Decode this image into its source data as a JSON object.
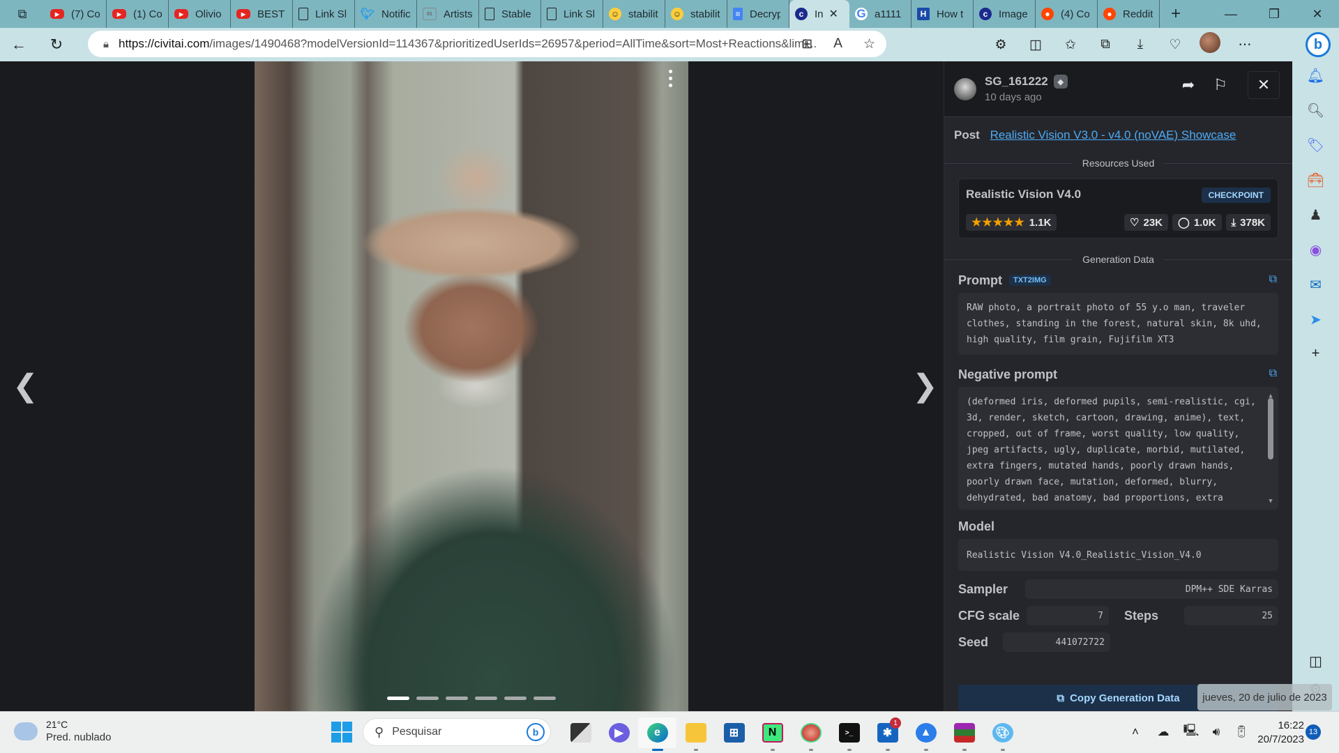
{
  "browser": {
    "tabs": [
      {
        "icon": "youtube-icon",
        "label": "(7) Co"
      },
      {
        "icon": "youtube-icon",
        "label": "(1) Co"
      },
      {
        "icon": "youtube-icon",
        "label": "Olivio"
      },
      {
        "icon": "youtube-icon",
        "label": "BEST A"
      },
      {
        "icon": "document-icon",
        "label": "Link Sl"
      },
      {
        "icon": "twitter-icon",
        "label": "Notific"
      },
      {
        "icon": "binary-grid-icon",
        "label": "Artists"
      },
      {
        "icon": "document-icon",
        "label": "Stable"
      },
      {
        "icon": "document-icon",
        "label": "Link Sl"
      },
      {
        "icon": "huggingface-icon",
        "label": "stabilit"
      },
      {
        "icon": "huggingface-icon",
        "label": "stabilit"
      },
      {
        "icon": "google-docs-icon",
        "label": "Decryp"
      },
      {
        "icon": "civitai-icon",
        "label": "In",
        "active": true
      },
      {
        "icon": "google-icon",
        "label": "a1111"
      },
      {
        "icon": "hashnode-icon",
        "label": "How t"
      },
      {
        "icon": "civitai-icon",
        "label": "Image"
      },
      {
        "icon": "reddit-icon",
        "label": "(4) Co"
      },
      {
        "icon": "reddit-icon",
        "label": "Reddit"
      }
    ],
    "url_host": "https://civitai.com",
    "url_rest": "/images/1490468?modelVersionId=114367&prioritizedUserIds=26957&period=AllTime&sort=Most+Reactions&limi..."
  },
  "viewer": {
    "carousel_count": 6,
    "carousel_active": 1
  },
  "panel": {
    "username": "SG_161222",
    "time_ago": "10 days ago",
    "post_label": "Post",
    "post_link": "Realistic Vision V3.0 - v4.0 (noVAE) Showcase",
    "resources_title": "Resources Used",
    "resource": {
      "name": "Realistic Vision V4.0",
      "type": "CHECKPOINT",
      "rating_stars": 5,
      "rating_count": "1.1K",
      "likes": "23K",
      "comments": "1.0K",
      "downloads": "378K"
    },
    "generation_title": "Generation Data",
    "prompt_label": "Prompt",
    "prompt_tag": "TXT2IMG",
    "prompt": "RAW photo, a portrait photo of 55 y.o man, traveler clothes, standing in the forest, natural skin, 8k uhd, high quality, film grain, Fujifilm XT3",
    "negative_label": "Negative prompt",
    "negative_prompt": "(deformed iris, deformed pupils, semi-realistic, cgi, 3d, render, sketch, cartoon, drawing, anime), text, cropped, out of frame, worst quality, low quality, jpeg artifacts, ugly, duplicate, morbid, mutilated, extra fingers, mutated hands, poorly drawn hands, poorly drawn face, mutation, deformed, blurry, dehydrated, bad anatomy, bad proportions, extra limbs, cloned face, disfigured",
    "model_label": "Model",
    "model": "Realistic Vision V4.0_Realistic_Vision_V4.0",
    "sampler_label": "Sampler",
    "sampler": "DPM++ SDE Karras",
    "cfg_label": "CFG scale",
    "cfg": "7",
    "steps_label": "Steps",
    "steps": "25",
    "seed_label": "Seed",
    "seed": "441072722",
    "copy_button": "Copy Generation Data"
  },
  "tooltip": "jueves, 20 de julio de 2023",
  "taskbar": {
    "temperature": "21°C",
    "weather": "Pred. nublado",
    "search_placeholder": "Pesquisar",
    "time": "16:22",
    "date": "20/7/2023",
    "notifications": "13",
    "slack_badge": "1"
  }
}
